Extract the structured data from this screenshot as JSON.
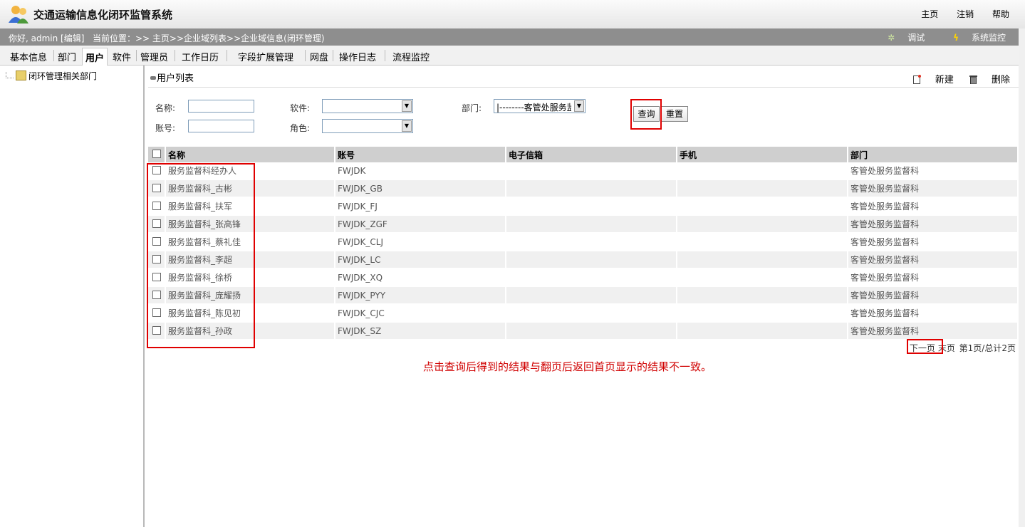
{
  "app": {
    "title": "交通运输信息化闭环监管系统"
  },
  "top_nav": [
    "主页",
    "注销",
    "帮助"
  ],
  "info_bar": {
    "greeting": "你好, admin [编辑]",
    "location": "当前位置：>> 主页>>企业域列表>>企业域信息(闭环管理)",
    "tools": [
      "调试",
      "系统监控"
    ]
  },
  "tabs": [
    "基本信息",
    "部门",
    "用户",
    "软件",
    "管理员",
    "工作日历",
    "字段扩展管理",
    "网盘",
    "操作日志",
    "流程监控"
  ],
  "sidebar": {
    "tree_root": "闭环管理相关部门"
  },
  "panel": {
    "title": "用户列表",
    "new_label": "新建",
    "delete_label": "删除"
  },
  "search": {
    "name_label": "名称:",
    "account_label": "账号:",
    "software_label": "软件:",
    "role_label": "角色:",
    "dept_label": "部门:",
    "dept_value": "|--------客管处服务监",
    "software_value": "",
    "role_value": "",
    "query_label": "查询",
    "reset_label": "重置"
  },
  "table": {
    "headers": [
      "名称",
      "账号",
      "电子信箱",
      "手机",
      "部门"
    ],
    "rows": [
      {
        "name": "服务监督科经办人",
        "account": "FWJDK",
        "email": "",
        "phone": "",
        "dept": "客管处服务监督科"
      },
      {
        "name": "服务监督科_古彬",
        "account": "FWJDK_GB",
        "email": "",
        "phone": "",
        "dept": "客管处服务监督科"
      },
      {
        "name": "服务监督科_扶军",
        "account": "FWJDK_FJ",
        "email": "",
        "phone": "",
        "dept": "客管处服务监督科"
      },
      {
        "name": "服务监督科_张高锋",
        "account": "FWJDK_ZGF",
        "email": "",
        "phone": "",
        "dept": "客管处服务监督科"
      },
      {
        "name": "服务监督科_蔡礼佳",
        "account": "FWJDK_CLJ",
        "email": "",
        "phone": "",
        "dept": "客管处服务监督科"
      },
      {
        "name": "服务监督科_李超",
        "account": "FWJDK_LC",
        "email": "",
        "phone": "",
        "dept": "客管处服务监督科"
      },
      {
        "name": "服务监督科_徐桥",
        "account": "FWJDK_XQ",
        "email": "",
        "phone": "",
        "dept": "客管处服务监督科"
      },
      {
        "name": "服务监督科_庞耀扬",
        "account": "FWJDK_PYY",
        "email": "",
        "phone": "",
        "dept": "客管处服务监督科"
      },
      {
        "name": "服务监督科_陈见初",
        "account": "FWJDK_CJC",
        "email": "",
        "phone": "",
        "dept": "客管处服务监督科"
      },
      {
        "name": "服务监督科_孙政",
        "account": "FWJDK_SZ",
        "email": "",
        "phone": "",
        "dept": "客管处服务监督科"
      }
    ]
  },
  "pager": {
    "next": "下一页",
    "last": "末页",
    "info": "第1页/总计2页"
  },
  "annotation": "点击查询后得到的结果与翻页后返回首页显示的结果不一致。",
  "colors": {
    "annotation": "#d00000",
    "infobar": "#8e8e8e",
    "header": "#cfcfcf"
  }
}
